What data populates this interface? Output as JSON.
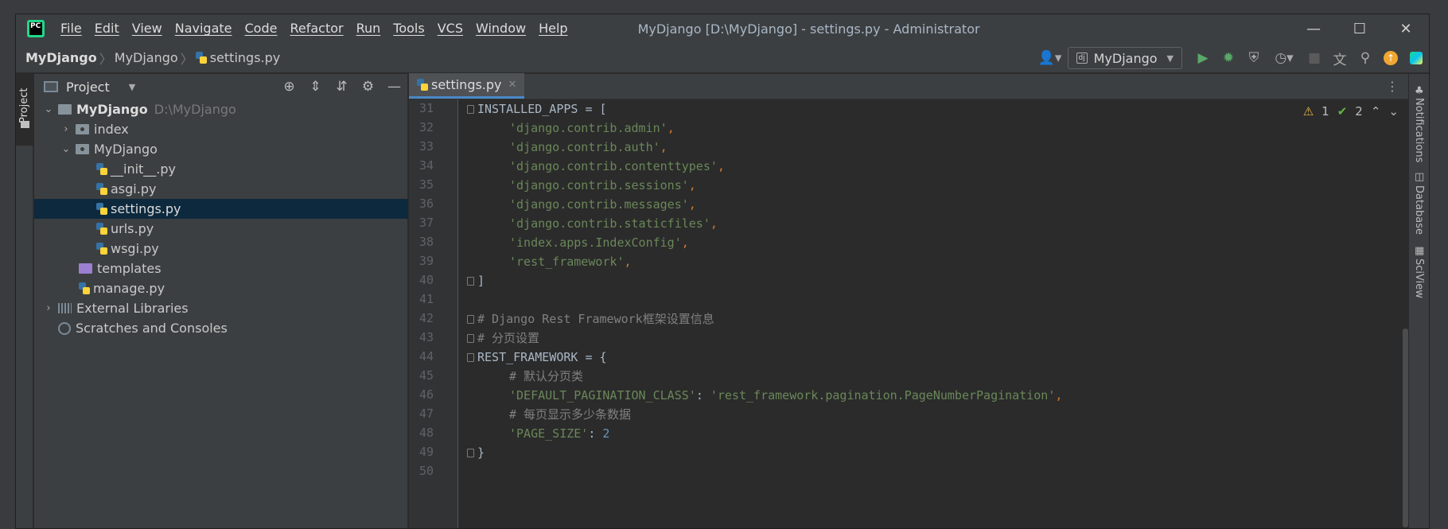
{
  "titlebar": {
    "menu": [
      "File",
      "Edit",
      "View",
      "Navigate",
      "Code",
      "Refactor",
      "Run",
      "Tools",
      "VCS",
      "Window",
      "Help"
    ],
    "title": "MyDjango [D:\\MyDjango] - settings.py - Administrator",
    "logo_text": "PC"
  },
  "breadcrumb": {
    "project": "MyDjango",
    "folder": "MyDjango",
    "file": "settings.py"
  },
  "toolbar": {
    "run_config": "MyDjango",
    "run_config_icon": "dj"
  },
  "left_stripe": {
    "project_tab": "Project"
  },
  "right_stripe": {
    "items": [
      "Notifications",
      "Database",
      "SciView"
    ]
  },
  "project_panel": {
    "title": "Project",
    "tree": [
      {
        "label": "MyDjango",
        "hint": "D:\\MyDjango",
        "bold": true
      },
      {
        "label": "index"
      },
      {
        "label": "MyDjango"
      },
      {
        "label": "__init__.py"
      },
      {
        "label": "asgi.py"
      },
      {
        "label": "settings.py",
        "selected": true
      },
      {
        "label": "urls.py"
      },
      {
        "label": "wsgi.py"
      },
      {
        "label": "templates"
      },
      {
        "label": "manage.py"
      },
      {
        "label": "External Libraries"
      },
      {
        "label": "Scratches and Consoles"
      }
    ]
  },
  "editor": {
    "tab": "settings.py",
    "inspections": {
      "warnings": "1",
      "weak_warnings": "2"
    },
    "line_numbers": [
      "31",
      "32",
      "33",
      "34",
      "35",
      "36",
      "37",
      "38",
      "39",
      "40",
      "41",
      "42",
      "43",
      "44",
      "45",
      "46",
      "47",
      "48",
      "49",
      "50"
    ],
    "lines": {
      "l31": "INSTALLED_APPS = [",
      "l32": "'django.contrib.admin'",
      "l33": "'django.contrib.auth'",
      "l34": "'django.contrib.contenttypes'",
      "l35": "'django.contrib.sessions'",
      "l36": "'django.contrib.messages'",
      "l37": "'django.contrib.staticfiles'",
      "l38": "'index.apps.IndexConfig'",
      "l39": "'rest_framework'",
      "l40": "]",
      "l42": "# Django Rest Framework框架设置信息",
      "l43": "# 分页设置",
      "l44": "REST_FRAMEWORK = {",
      "l45": "# 默认分页类",
      "l46_key": "'DEFAULT_PAGINATION_CLASS'",
      "l46_val": "'rest_framework.pagination.PageNumberPagination'",
      "l47": "# 每页显示多少条数据",
      "l48_key": "'PAGE_SIZE'",
      "l48_val": "2",
      "l49": "}",
      "comma": ",",
      "colon": ": "
    }
  }
}
